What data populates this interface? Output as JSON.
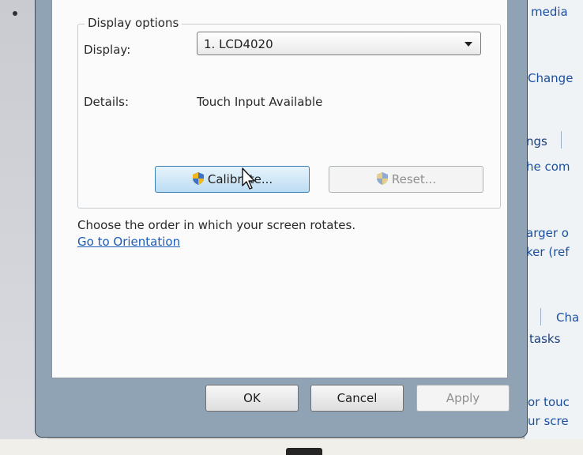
{
  "dialog": {
    "group_title": "Display options",
    "display_label": "Display:",
    "display_value": "1. LCD4020",
    "details_label": "Details:",
    "details_value": "Touch Input Available",
    "calibrate_label": "Calibrate...",
    "reset_label": "Reset...",
    "orientation_text": "Choose the order in which your screen rotates.",
    "orientation_link": "Go to Orientation",
    "ok_label": "OK",
    "cancel_label": "Cancel",
    "apply_label": "Apply"
  },
  "background_panel": {
    "lines": [
      "media",
      "Change",
      "ngs",
      "he com",
      "arger o",
      "ker (ref",
      "Cha",
      "tasks",
      "or touc",
      "ur scre"
    ]
  },
  "colors": {
    "link": "#1a5cb8",
    "dialog_frame": "#8fa3b5",
    "focus_button": "#bcdcf3"
  }
}
